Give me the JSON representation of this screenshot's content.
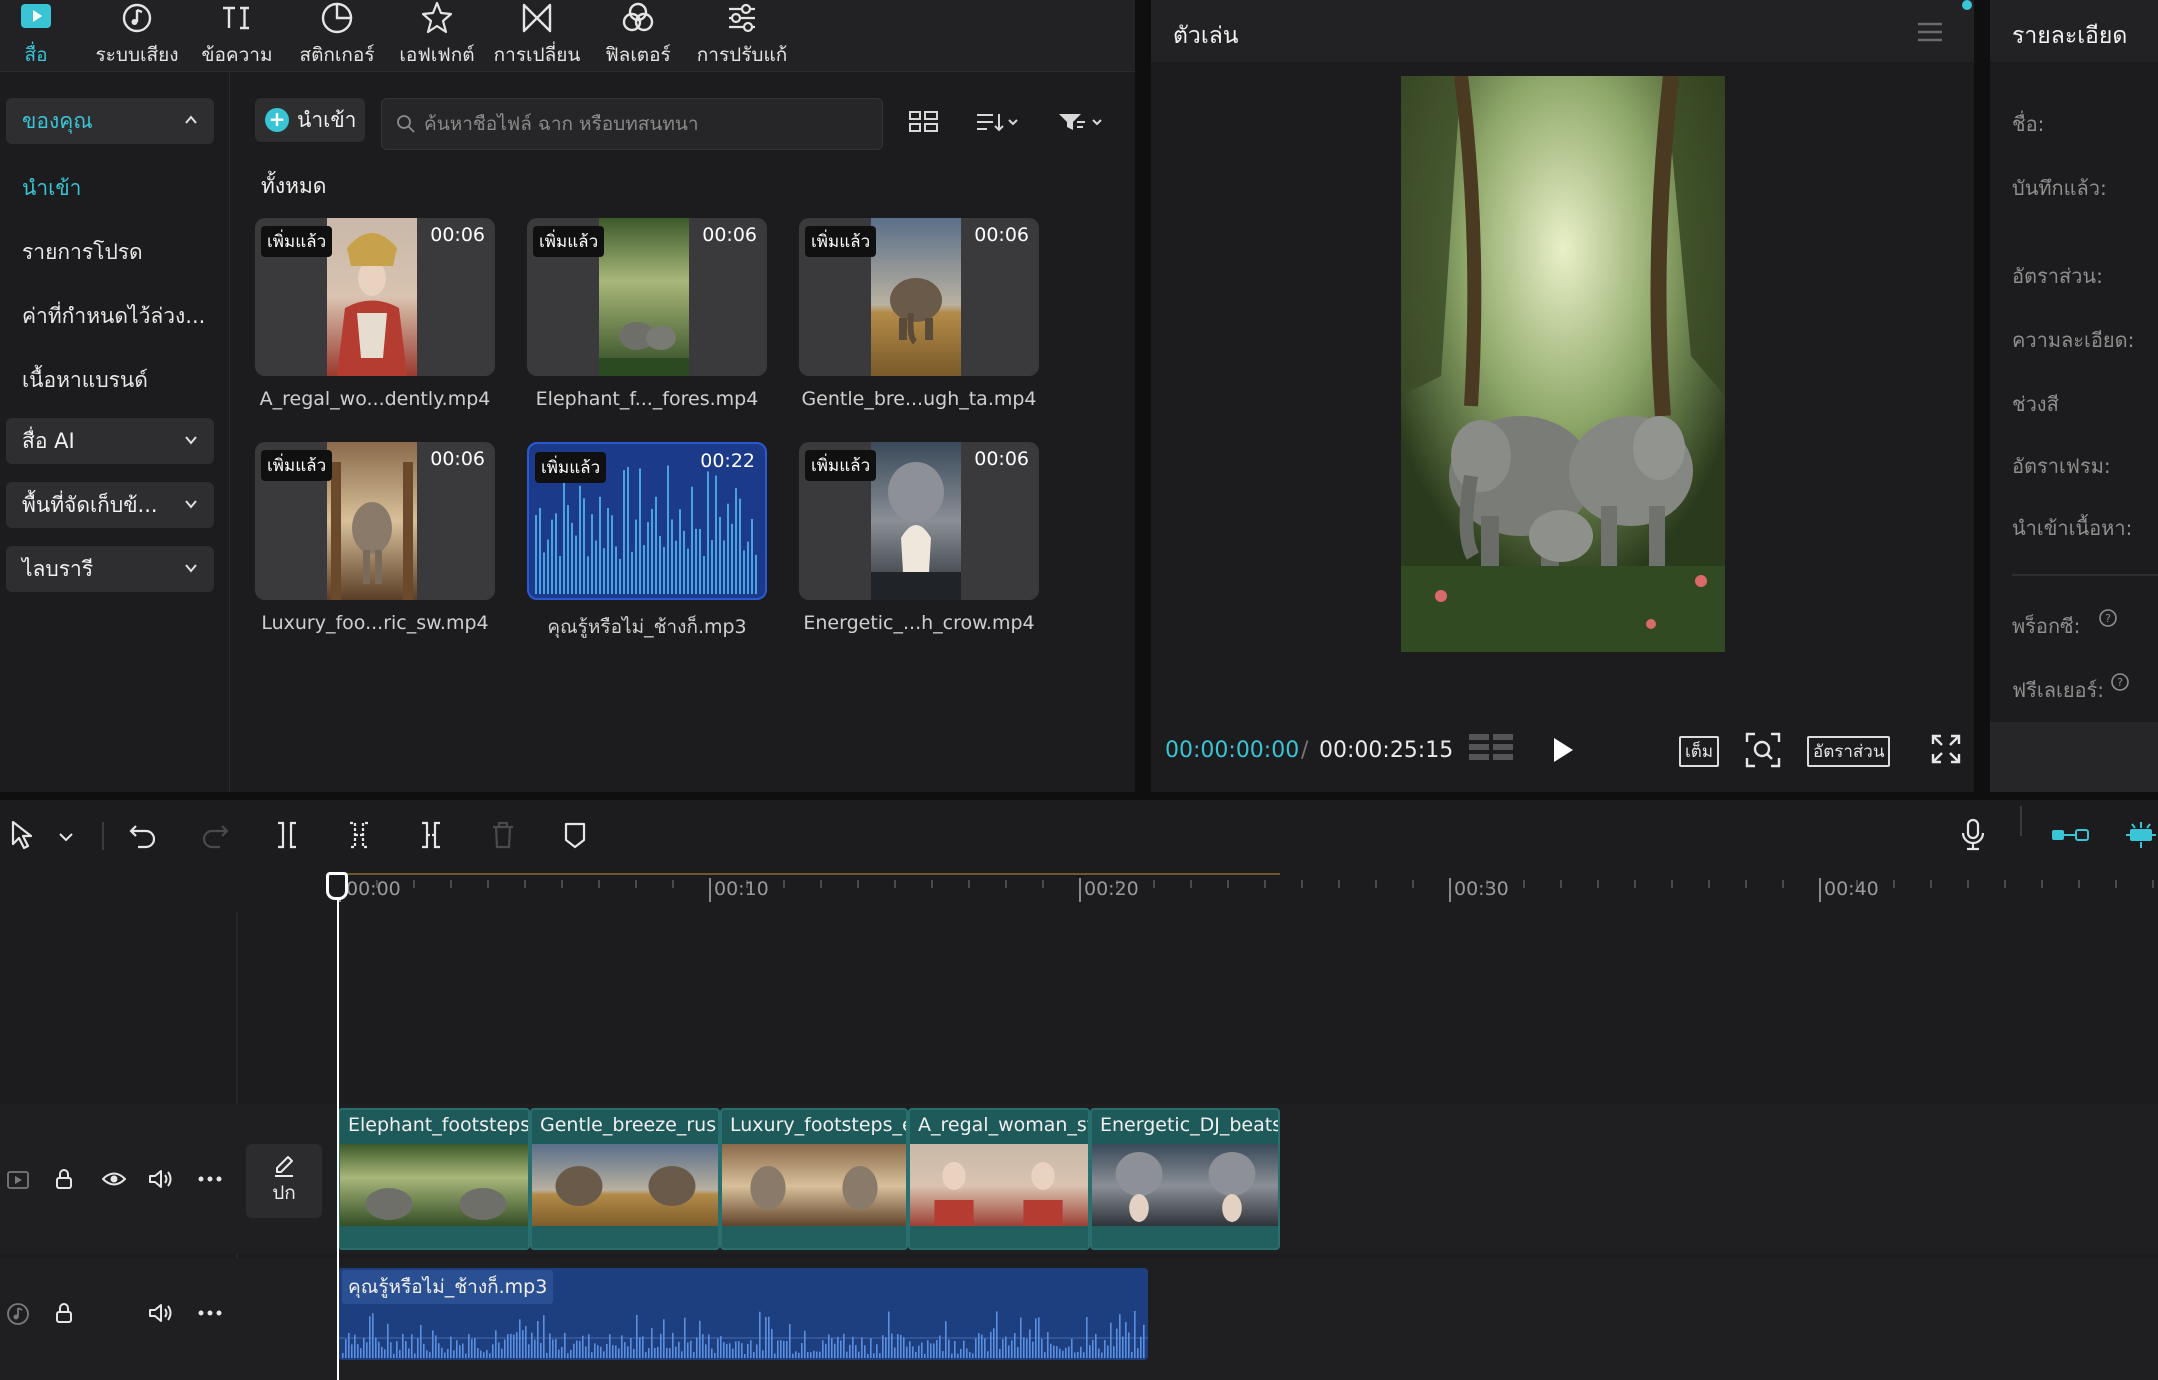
{
  "toolbar": {
    "tabs": [
      {
        "label": "สื่อ",
        "icon": "media-icon",
        "active": true
      },
      {
        "label": "ระบบเสียง",
        "icon": "audio-icon"
      },
      {
        "label": "ข้อความ",
        "icon": "text-icon"
      },
      {
        "label": "สติกเกอร์",
        "icon": "sticker-icon"
      },
      {
        "label": "เอฟเฟกต์",
        "icon": "effects-icon"
      },
      {
        "label": "การเปลี่ยน",
        "icon": "transitions-icon"
      },
      {
        "label": "ฟิลเตอร์",
        "icon": "filters-icon"
      },
      {
        "label": "การปรับแก้",
        "icon": "adjustment-icon"
      }
    ]
  },
  "sidebar": {
    "yours": "ของคุณ",
    "import": "นำเข้า",
    "favorites": "รายการโปรด",
    "presets": "ค่าที่กำหนดไว้ล่วง...",
    "brand": "เนื้อหาแบรนด์",
    "ai_media": "สื่อ AI",
    "storage": "พื้นที่จัดเก็บข้...",
    "library": "ไลบรารี"
  },
  "media": {
    "import_label": "นำเข้า",
    "search_placeholder": "ค้นหาชื่อไฟล์ ฉาก หรือบทสนทนา",
    "all_label": "ทั้งหมด",
    "badge": "เพิ่มแล้ว",
    "items": [
      {
        "name": "A_regal_wo...dently.mp4",
        "duration": "00:06",
        "art": "woman"
      },
      {
        "name": "Elephant_f..._fores.mp4",
        "duration": "00:06",
        "art": "forest"
      },
      {
        "name": "Gentle_bre...ugh_ta.mp4",
        "duration": "00:06",
        "art": "savanna"
      },
      {
        "name": "Luxury_foo...ric_sw.mp4",
        "duration": "00:06",
        "art": "palace"
      },
      {
        "name": "คุณรู้หรือไม่_ช้างก็.mp3",
        "duration": "00:22",
        "art": "audio"
      },
      {
        "name": "Energetic_...h_crow.mp4",
        "duration": "00:06",
        "art": "dj"
      }
    ]
  },
  "player": {
    "title": "ตัวเล่น",
    "current_time": "00:00:00:00",
    "separator": "/",
    "total_time": "00:00:25:15",
    "full_label": "เต็ม",
    "ratio_label": "อัตราส่วน"
  },
  "details": {
    "title": "รายละเอียด",
    "labels": [
      "ชื่อ:",
      "บันทึกแล้ว:",
      "อัตราส่วน:",
      "ความละเอียด:",
      "ช่วงสี",
      "อัตราเฟรม:",
      "นำเข้าเนื้อหา:",
      "พร็อกซี:",
      "ฟรีเลเยอร์:"
    ]
  },
  "timeline": {
    "ruler": [
      "00:00",
      "00:10",
      "00:20",
      "00:30",
      "00:40"
    ],
    "cover_label": "ปก",
    "video_clips": [
      {
        "name": "Elephant_footsteps",
        "art": "forest"
      },
      {
        "name": "Gentle_breeze_rus",
        "art": "savanna"
      },
      {
        "name": "Luxury_footsteps_e",
        "art": "palace"
      },
      {
        "name": "A_regal_woman_st",
        "art": "woman"
      },
      {
        "name": "Energetic_DJ_beats",
        "art": "dj"
      }
    ],
    "audio_clip": "คุณรู้หรือไม่_ช้างก็.mp3"
  },
  "colors": {
    "accent": "#39c5d6",
    "panel": "#1c1c1e",
    "video_clip": "#1f5a5a",
    "audio_clip": "#1d3f80"
  }
}
